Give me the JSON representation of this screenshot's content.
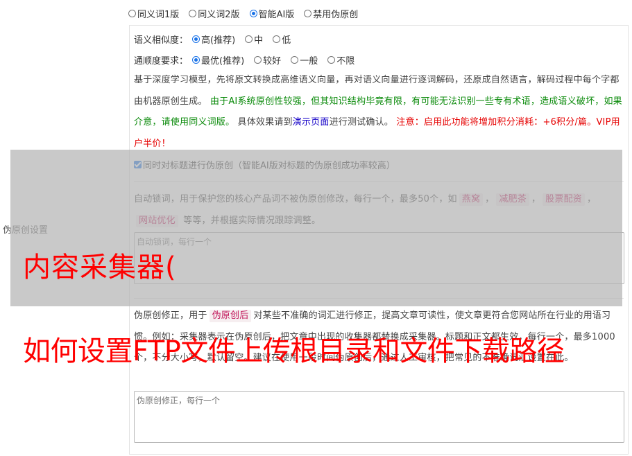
{
  "side_label": "伪原创设置",
  "mode_options": [
    {
      "label": "同义词1版",
      "selected": false
    },
    {
      "label": "同义词2版",
      "selected": false
    },
    {
      "label": "智能AI版",
      "selected": true
    },
    {
      "label": "禁用伪原创",
      "selected": false
    }
  ],
  "similarity": {
    "label": "语义相似度：",
    "options": [
      {
        "label": "高(推荐)",
        "selected": true
      },
      {
        "label": "中",
        "selected": false
      },
      {
        "label": "低",
        "selected": false
      }
    ]
  },
  "fluency": {
    "label": "通顺度要求：",
    "options": [
      {
        "label": "最优(推荐)",
        "selected": true
      },
      {
        "label": "较好",
        "selected": false
      },
      {
        "label": "一般",
        "selected": false
      },
      {
        "label": "不限",
        "selected": false
      }
    ]
  },
  "ai_desc": {
    "part1": "基于深度学习模型，先将原文转换成高维语义向量，再对语义向量进行逐词解码，还原成自然语言，解码过程中每个字都由机器原创生成。 ",
    "green": "由于AI系统原创性较强，但其知识结构毕竟有限，有可能无法识别一些专有术语，造成语义破坏，如果介意，请使用同义词版。",
    "part2": " 具体效果请到",
    "link": "演示页面",
    "part3": "进行测试确认。 ",
    "red": "注意：启用此功能将增加积分消耗：+6积分/篇。VIP用户半价！"
  },
  "title_checkbox": {
    "label": "同时对标题进行伪原创（智能AI版对标题的伪原创成功率较高）",
    "checked": true
  },
  "lock_words": {
    "intro": "自动锁词，用于保护您的核心产品词不被伪原创修改，每行一个，最多50个，如",
    "examples": [
      "燕窝",
      "减肥茶",
      "股票配资",
      "网站优化"
    ],
    "sep1": "，",
    "sep2": "，",
    "sep3": "，",
    "outro": " 等等，并根据实际情况跟踪调整。",
    "placeholder": "自动锁词，每行一个"
  },
  "correction": {
    "intro": "伪原创修正，用于",
    "tag": "伪原创后",
    "text": "对某些不准确的词汇进行修正，提高文章可读性，使文章更符合您网站所在行业的用语习惯。例如：采集器表示在伪原创后，把文章中出现的收集器都替换成采集器。标题和正文都生效，每行一个，最多1000个，不分大小写，默认留空。建议在使用一段时间伪原创后，通过人工审核，把常见的不准确词汇设置在此。",
    "placeholder": "伪原创修正，每行一个"
  },
  "watermark": {
    "line1": "内容采集器(",
    "line2": "如何设置FTP文件上传根目录和文件下载路径"
  }
}
